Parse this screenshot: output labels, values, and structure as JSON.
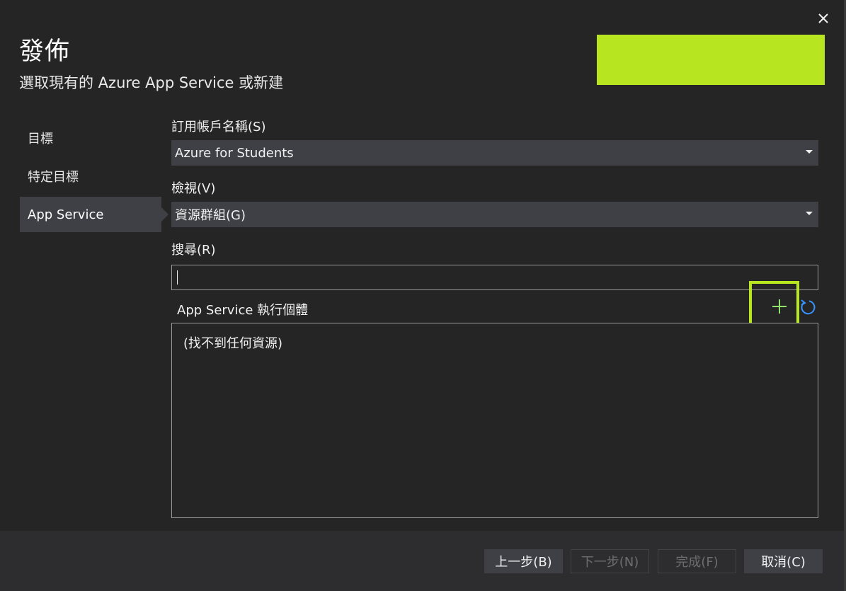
{
  "dialog": {
    "title": "發佈",
    "subtitle": "選取現有的 Azure App Service 或新建",
    "close_icon": "close-icon",
    "brand_color": "#b7e620"
  },
  "nav": {
    "items": [
      {
        "label": "目標",
        "active": false
      },
      {
        "label": "特定目標",
        "active": false
      },
      {
        "label": "App Service",
        "active": true
      }
    ]
  },
  "form": {
    "subscription_label": "訂用帳戶名稱(S)",
    "subscription_value": "Azure for Students",
    "view_label": "檢視(V)",
    "view_value": "資源群組(G)",
    "search_label": "搜尋(R)",
    "search_value": ""
  },
  "instances": {
    "header": "App Service 執行個體",
    "empty_text": "(找不到任何資源)",
    "add_icon": "plus-icon",
    "refresh_icon": "refresh-icon"
  },
  "footer": {
    "back_label": "上一步(B)",
    "next_label": "下一步(N)",
    "finish_label": "完成(F)",
    "cancel_label": "取消(C)"
  }
}
